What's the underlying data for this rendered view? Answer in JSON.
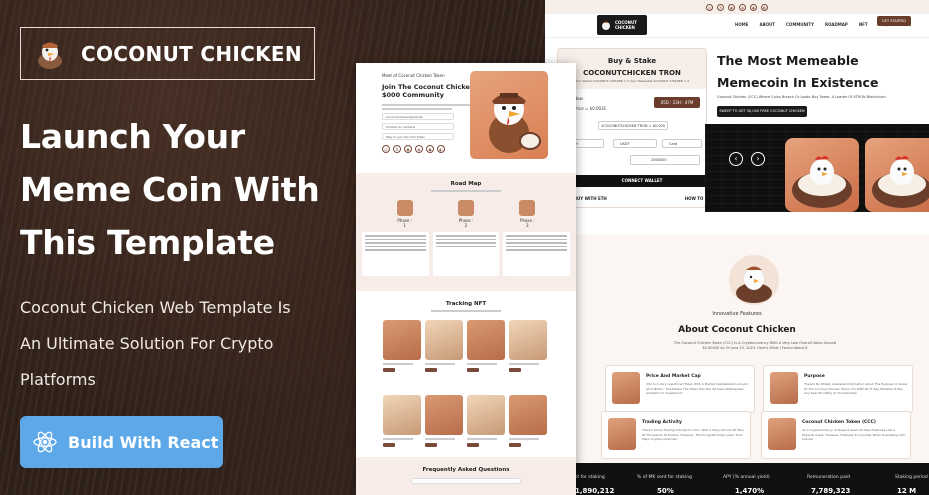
{
  "promo": {
    "brand": "COCONUT CHICKEN",
    "headline_lines": [
      "Launch Your",
      "Meme Coin With",
      "This Template"
    ],
    "subline_lines": [
      "Coconut Chicken Web Template Is",
      "An Ultimate Solution For Crypto",
      "Platforms"
    ],
    "cta_label": "Build With React",
    "cta_icon": "react-atom-icon",
    "colors": {
      "cta": "#5ca8e8",
      "background": "#2e2019"
    }
  },
  "mock1": {
    "hero_small": "Meet of Coconut Chicken Token",
    "hero_title": "Join The Coconut Chicken $000 Community",
    "fields": [
      "Coconutchicken@ethnet",
      "Chicken & chickens",
      "Way to join the CCC token"
    ],
    "socials": [
      "◎",
      "X",
      "◉",
      "◈",
      "◆",
      "◐"
    ],
    "roadmap_title": "Road Map",
    "phases": [
      "Phase : 1",
      "Phase : 2",
      "Phase : 3"
    ],
    "nft_title": "Tracking NFT",
    "faq_title": "Frequently Asked Questions"
  },
  "mock2": {
    "top_icons": [
      "◎",
      "X",
      "◉",
      "◈",
      "◆",
      "◐"
    ],
    "logo_line1": "COCONUT",
    "logo_line2": "CHICKEN",
    "menu": [
      "HOME",
      "ABOUT",
      "COMMUNITY",
      "ROADMAP",
      "NFT",
      "FAQ",
      "TEAM"
    ],
    "get_started": "GET STARTED",
    "buy_title1": "Buy & Stake",
    "buy_title2": "COCONUTCHICKEN TRON",
    "buy_sub": "Your Staked COCONUT CHICKEN = 0   Your Stakeable COCONUT CHICKEN = 0",
    "now_label": "Now",
    "price_label": "Price = $0.0031",
    "timer": "05D : 23H : 47M",
    "rate": "1COCONUTCHICKEN TRON = $0.005",
    "pay_options": [
      "ETH",
      "USDT",
      "Card"
    ],
    "amount": "2000000",
    "connect": "CONNECT WALLET",
    "link_left": "BUY WITH ETH",
    "link_right": "HOW TO BUY",
    "hero_title_lines": [
      "The Most Memeable",
      "Memecoin In Existence"
    ],
    "hero_desc": "Coconut Chicken (CCC) Where Coins Breach Or Looks Buy Tweet, A Leader Of $TRON Blockchain",
    "hero_btn": "SWEEP TO GET 50,000 FREE COCONUT CHICKEN",
    "innovative": "Innovative Features",
    "about_title": "About Coconut Chicken",
    "about_desc": "The Coconut Chicken Token (CCC) Is A Cryptocurrency With A Very Low Overall Value Around $0.00000 As Of June 10, 2024. Here's What I Found About It",
    "features": [
      {
        "title": "Price And Market Cap",
        "desc": "CCC Is A Very Low-Priced Token With A Market Capitalization Around $3.4 Million. This Means The Token Has Not Yet Seen Widespread Adoption Or Investment"
      },
      {
        "title": "Purpose",
        "desc": "There's No Widely Available Information About The Purpose Or Goals Of The Coconut Chicken Token. It's Difficult To Say Whether It Has Any Specific Utility Or Functionality"
      },
      {
        "title": "Trading Activity",
        "desc": "There's Some Trading Activity For CCC, With A Daily Volume Of Tens Of Thousands Of Dollars. However, This Is Significantly Lower Than Major Cryptocurrencies"
      },
      {
        "title": "Coconut Chicken Token (CCC)",
        "desc": "As A Cryptocurrency, It Doesn't Seem To Have Features Like A Physical Asset. However, Features To Consider When Evaluating CCC Include"
      }
    ],
    "stats": [
      {
        "label": "current for staking",
        "value": "1,890,212"
      },
      {
        "label": "% of MK sent for staking",
        "value": "50%"
      },
      {
        "label": "APY (% annual yield)",
        "value": "1,470%"
      },
      {
        "label": "Remuneration paid",
        "value": "7,789,323"
      },
      {
        "label": "Staking period",
        "value": "12 M"
      }
    ]
  }
}
